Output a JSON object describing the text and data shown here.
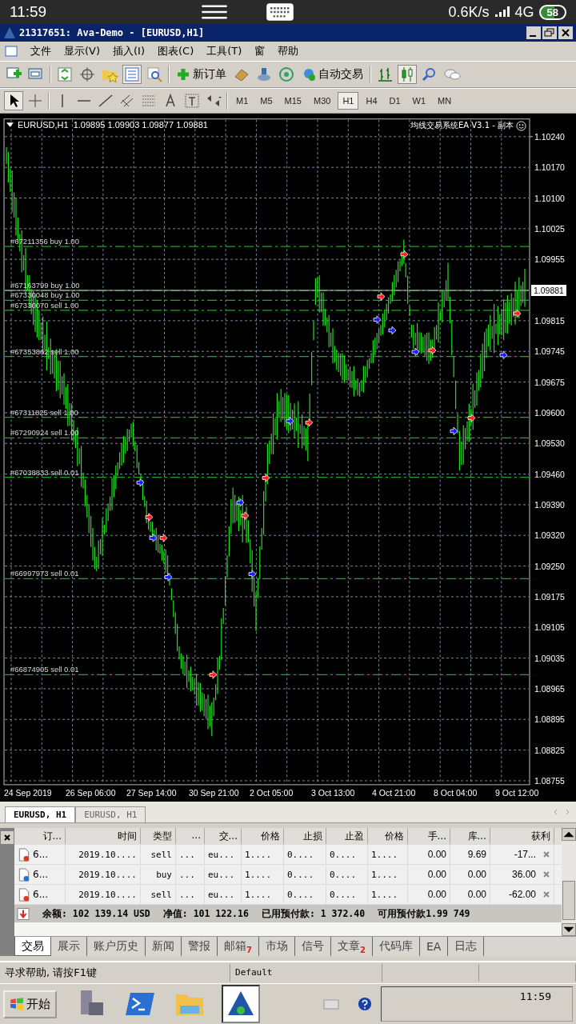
{
  "phone_status": {
    "time": "11:59",
    "speed": "0.6K/s",
    "network": "4G",
    "battery": "58"
  },
  "window": {
    "title": "21317651: Ava-Demo - [EURUSD,H1]"
  },
  "menu": [
    "文件",
    "显示(V)",
    "插入(I)",
    "图表(C)",
    "工具(T)",
    "窗",
    "帮助"
  ],
  "toolbar": {
    "new_order": "新订单",
    "auto_trading": "自动交易"
  },
  "timeframes": [
    {
      "label": "M1",
      "selected": false
    },
    {
      "label": "M5",
      "selected": false
    },
    {
      "label": "M15",
      "selected": false
    },
    {
      "label": "M30",
      "selected": false
    },
    {
      "label": "H1",
      "selected": true
    },
    {
      "label": "H4",
      "selected": false
    },
    {
      "label": "D1",
      "selected": false
    },
    {
      "label": "W1",
      "selected": false
    },
    {
      "label": "MN",
      "selected": false
    }
  ],
  "chart": {
    "header": "EURUSD,H1  1.09895 1.09903 1.09877 1.09881",
    "expert": "均线交易系统EA V3.1 - 副本",
    "current_price": "1.09881",
    "price_labels": [
      "1.10240",
      "1.10170",
      "1.10100",
      "1.10025",
      "1.09955",
      "1.09815",
      "1.09745",
      "1.09675",
      "1.09600",
      "1.09530",
      "1.09460",
      "1.09390",
      "1.09320",
      "1.09250",
      "1.09175",
      "1.09105",
      "1.09035",
      "1.08965",
      "1.08895",
      "1.08825",
      "1.08755"
    ],
    "time_labels": [
      "24 Sep 2019",
      "26 Sep 06:00",
      "27 Sep 14:00",
      "30 Sep 21:00",
      "2 Oct 05:00",
      "3 Oct 13:00",
      "4 Oct 21:00",
      "8 Oct 04:00",
      "9 Oct 12:00"
    ],
    "orders": [
      "#67211356 buy 1.00",
      "#67163799 buy 1.00",
      "#67330048 buy 1.00",
      "#67330070 sell 1.00",
      "#67353862 sell 1.00",
      "#67311825 sell 1.00",
      "#67290924 sell 1.00",
      "#67038833 sell 0.01",
      "#66997973 sell 0.01",
      "#66874905 sell 0.01"
    ]
  },
  "chart_tabs": [
    {
      "label": "EURUSD, H1",
      "selected": true
    },
    {
      "label": "EURUSD, H1",
      "selected": false
    }
  ],
  "trade_table": {
    "columns": [
      "订...",
      "时间",
      "类型",
      "...",
      "交...",
      "价格",
      "止损",
      "止盈",
      "价格",
      "手...",
      "库...",
      "获利"
    ],
    "rows": [
      {
        "kind": "sell",
        "cells": [
          "6...",
          "2019.10....",
          "sell",
          "...",
          "eu...",
          "1....",
          "0....",
          "0....",
          "1....",
          "0.00",
          "9.69",
          "-17..."
        ]
      },
      {
        "kind": "buy",
        "cells": [
          "6...",
          "2019.10....",
          "buy",
          "...",
          "eu...",
          "1....",
          "0....",
          "0....",
          "1....",
          "0.00",
          "0.00",
          "36.00"
        ]
      },
      {
        "kind": "sell",
        "cells": [
          "6...",
          "2019.10....",
          "sell",
          "...",
          "eu...",
          "1....",
          "0....",
          "0....",
          "1....",
          "0.00",
          "0.00",
          "-62.00"
        ]
      }
    ],
    "summary": [
      "余额: 102 139.14 USD",
      "净值: 101 122.16",
      "已用预付款: 1 372.40",
      "可用预付款1.99 749"
    ]
  },
  "terminal_tabs": [
    {
      "label": "交易",
      "selected": true
    },
    {
      "label": "展示",
      "selected": false
    },
    {
      "label": "账户历史",
      "selected": false
    },
    {
      "label": "新闻",
      "selected": false
    },
    {
      "label": "警报",
      "selected": false
    },
    {
      "label": "邮箱",
      "selected": false,
      "badge": "7"
    },
    {
      "label": "市场",
      "selected": false
    },
    {
      "label": "信号",
      "selected": false
    },
    {
      "label": "文章",
      "selected": false,
      "badge": "2"
    },
    {
      "label": "代码库",
      "selected": false
    },
    {
      "label": "EA",
      "selected": false
    },
    {
      "label": "日志",
      "selected": false
    }
  ],
  "status_bar": [
    "寻求帮助, 请按F1键",
    "Default"
  ],
  "taskbar": {
    "start": "开始",
    "clock": "11:59"
  }
}
